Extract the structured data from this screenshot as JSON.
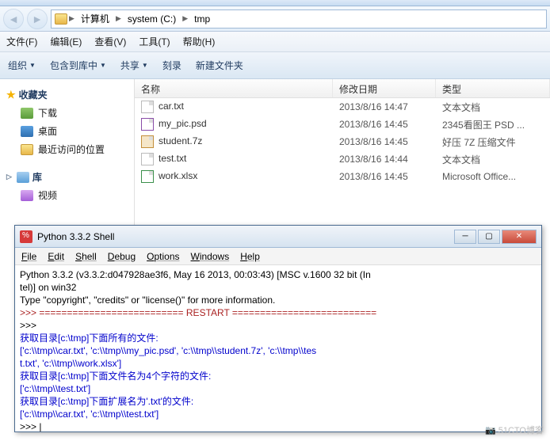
{
  "breadcrumbs": [
    "计算机",
    "system (C:)",
    "tmp"
  ],
  "menubar": [
    "文件(F)",
    "编辑(E)",
    "查看(V)",
    "工具(T)",
    "帮助(H)"
  ],
  "toolbar": [
    "组织",
    "包含到库中",
    "共享",
    "刻录",
    "新建文件夹"
  ],
  "sidebar": {
    "fav_header": "收藏夹",
    "fav_items": [
      "下载",
      "桌面",
      "最近访问的位置"
    ],
    "lib_header": "库",
    "lib_items": [
      "视频"
    ]
  },
  "columns": {
    "name": "名称",
    "date": "修改日期",
    "type": "类型"
  },
  "files": [
    {
      "name": "car.txt",
      "date": "2013/8/16 14:47",
      "type": "文本文档",
      "icon": "txt"
    },
    {
      "name": "my_pic.psd",
      "date": "2013/8/16 14:45",
      "type": "2345看图王 PSD ...",
      "icon": "psd"
    },
    {
      "name": "student.7z",
      "date": "2013/8/16 14:45",
      "type": "好压 7Z 压缩文件",
      "icon": "z7"
    },
    {
      "name": "test.txt",
      "date": "2013/8/16 14:44",
      "type": "文本文档",
      "icon": "txt"
    },
    {
      "name": "work.xlsx",
      "date": "2013/8/16 14:45",
      "type": "Microsoft Office...",
      "icon": "xls"
    }
  ],
  "pywin": {
    "title": "Python 3.3.2 Shell",
    "menu": [
      "File",
      "Edit",
      "Shell",
      "Debug",
      "Options",
      "Windows",
      "Help"
    ],
    "banner1": "Python 3.3.2 (v3.3.2:d047928ae3f6, May 16 2013, 00:03:43) [MSC v.1600 32 bit (In",
    "banner2": "tel)] on win32",
    "banner3": "Type \"copyright\", \"credits\" or \"license()\" for more information.",
    "restart": ">>> ========================== RESTART ==========================",
    "prompt_empty": ">>>",
    "line1": "获取目录[c:\\tmp]下面所有的文件:",
    "line2": "['c:\\\\tmp\\\\car.txt', 'c:\\\\tmp\\\\my_pic.psd', 'c:\\\\tmp\\\\student.7z', 'c:\\\\tmp\\\\tes",
    "line3": "t.txt', 'c:\\\\tmp\\\\work.xlsx']",
    "line4": "获取目录[c:\\tmp]下面文件名为4个字符的文件:",
    "line5": "['c:\\\\tmp\\\\test.txt']",
    "line6": "获取目录[c:\\tmp]下面扩展名为'.txt'的文件:",
    "line7": "['c:\\\\tmp\\\\car.txt', 'c:\\\\tmp\\\\test.txt']",
    "cursor": ">>> |"
  },
  "watermark": "51CTO博客"
}
